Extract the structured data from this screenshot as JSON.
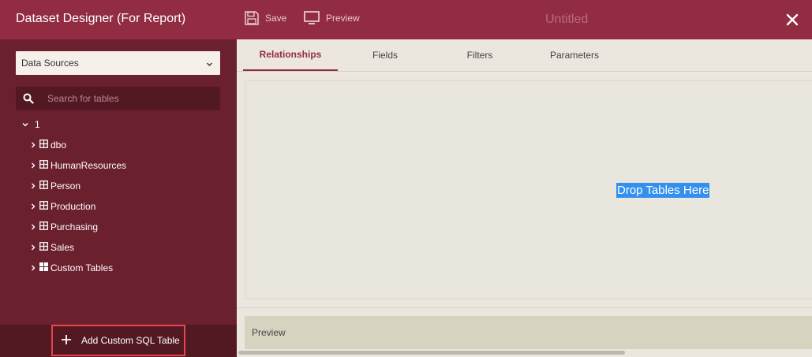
{
  "header": {
    "app_title": "Dataset Designer (For Report)",
    "save_label": "Save",
    "preview_label": "Preview",
    "doc_title": "Untitled"
  },
  "sidebar": {
    "data_source_selected": "Data Sources",
    "search_placeholder": "Search for tables",
    "tree_root": "1",
    "items": [
      {
        "label": "dbo",
        "icon": "table-grid-icon"
      },
      {
        "label": "HumanResources",
        "icon": "table-grid-icon"
      },
      {
        "label": "Person",
        "icon": "table-grid-icon"
      },
      {
        "label": "Production",
        "icon": "table-grid-icon"
      },
      {
        "label": "Purchasing",
        "icon": "table-grid-icon"
      },
      {
        "label": "Sales",
        "icon": "table-grid-icon"
      },
      {
        "label": "Custom Tables",
        "icon": "custom-tables-icon"
      }
    ],
    "add_custom_sql_label": "Add Custom SQL Table"
  },
  "main": {
    "tabs": [
      {
        "label": "Relationships",
        "active": true
      },
      {
        "label": "Fields",
        "active": false
      },
      {
        "label": "Filters",
        "active": false
      },
      {
        "label": "Parameters",
        "active": false
      }
    ],
    "drop_zone_text": "Drop Tables Here",
    "preview_label": "Preview"
  },
  "colors": {
    "header_bg": "#922c42",
    "sidebar_bg": "#6b202e",
    "accent": "#922c42",
    "highlight_border": "#e8454a",
    "selection": "#3390ee"
  }
}
